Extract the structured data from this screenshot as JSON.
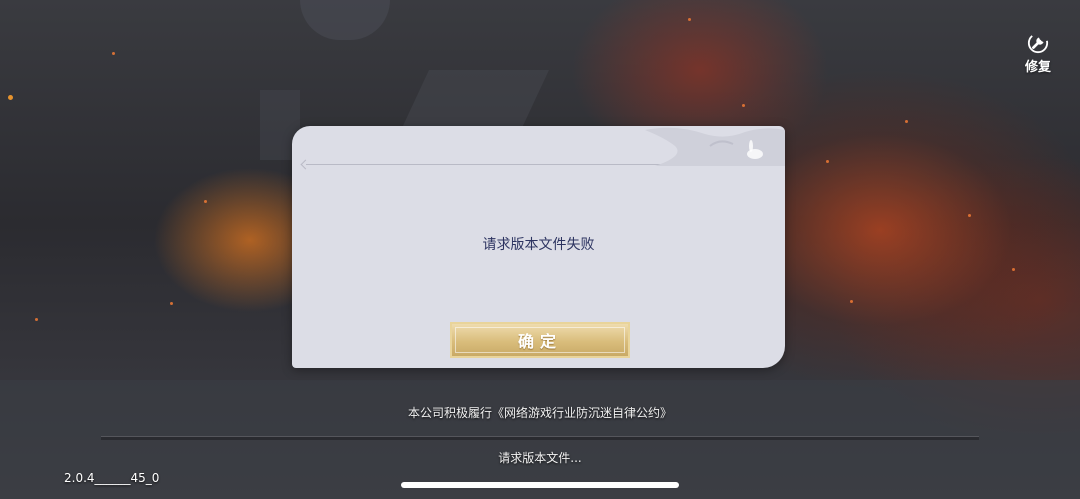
{
  "toolbar": {
    "repair_label": "修复"
  },
  "dialog": {
    "message": "请求版本文件失败",
    "confirm_label": "确定"
  },
  "footer": {
    "notice": "本公司积极履行《网络游戏行业防沉迷自律公约》",
    "status_text": "请求版本文件...",
    "progress_fraction": 0,
    "version": "2.0.4______45_0"
  },
  "colors": {
    "dialog_bg": "#dcdde6",
    "message_text": "#2c3360",
    "button_gold": "#d9bd7c"
  },
  "icons": {
    "repair": "wrench-repair-icon"
  }
}
